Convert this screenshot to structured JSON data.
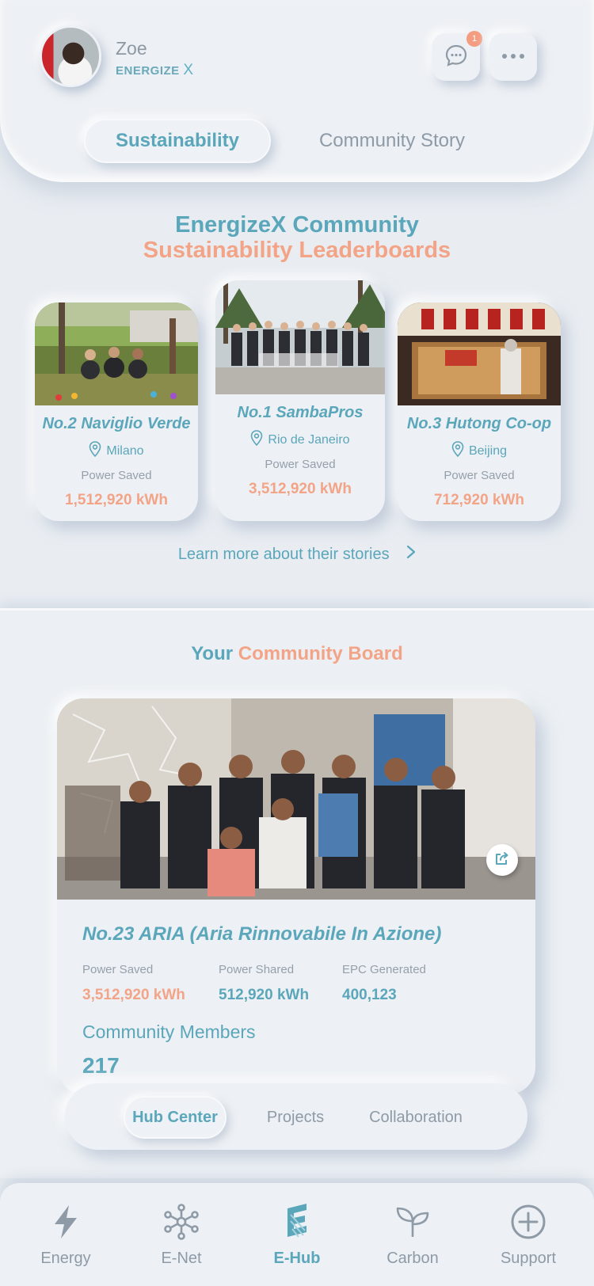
{
  "header": {
    "user_name": "Zoe",
    "brand_text": "ENERGIZE",
    "brand_x": "X",
    "notification_count": "1",
    "tabs": [
      {
        "label": "Sustainability",
        "active": true
      },
      {
        "label": "Community Story",
        "active": false
      }
    ]
  },
  "leaderboard": {
    "title_line1": "EnergizeX Community",
    "title_line2": "Sustainability Leaderboards",
    "entries": [
      {
        "rank_name": "No.2 Naviglio Verde",
        "location": "Milano",
        "metric_label": "Power Saved",
        "metric_value": "1,512,920 kWh"
      },
      {
        "rank_name": "No.1 SambaPros",
        "location": "Rio de Janeiro",
        "metric_label": "Power Saved",
        "metric_value": "3,512,920 kWh"
      },
      {
        "rank_name": "No.3 Hutong Co-op",
        "location": "Beijing",
        "metric_label": "Power Saved",
        "metric_value": "712,920 kWh"
      }
    ],
    "learn_more": "Learn more about their stories"
  },
  "community_board": {
    "title_prefix": "Your",
    "title_highlight": "Community Board",
    "name": "No.23 ARIA (Aria Rinnovabile In Azione)",
    "stats": [
      {
        "label": "Power Saved",
        "value": "3,512,920 kWh"
      },
      {
        "label": "Power Shared",
        "value": "512,920 kWh"
      },
      {
        "label": "EPC Generated",
        "value": "400,123"
      }
    ],
    "members_label": "Community Members",
    "members_count": "217",
    "subtabs": [
      {
        "label": "Hub Center",
        "active": true
      },
      {
        "label": "Projects",
        "active": false
      },
      {
        "label": "Collaboration",
        "active": false
      }
    ]
  },
  "bottom_nav": [
    {
      "label": "Energy",
      "icon": "lightning-icon"
    },
    {
      "label": "E-Net",
      "icon": "network-icon"
    },
    {
      "label": "E-Hub",
      "icon": "e-hub-logo-icon",
      "active": true
    },
    {
      "label": "Carbon",
      "icon": "sprout-icon"
    },
    {
      "label": "Support",
      "icon": "plus-circle-icon"
    }
  ],
  "colors": {
    "teal": "#5aa6ba",
    "coral": "#f3a487",
    "grey": "#8e9ba7",
    "background": "#e9edf2"
  }
}
